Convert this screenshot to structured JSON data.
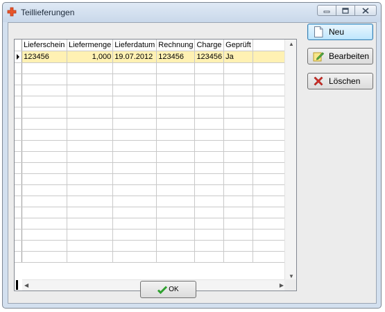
{
  "window": {
    "title": "Teillieferungen"
  },
  "table": {
    "columns": [
      "Lieferschein",
      "Liefermenge",
      "Lieferdatum",
      "Rechnung",
      "Charge",
      "Geprüft",
      ""
    ],
    "rows": [
      [
        "123456",
        "1,000",
        "19.07.2012",
        "123456",
        "123456",
        "Ja",
        ""
      ]
    ],
    "empty_rows": 18
  },
  "buttons": {
    "new_label": "Neu",
    "edit_label": "Bearbeiten",
    "delete_label": "Löschen",
    "ok_label": "OK"
  },
  "colors": {
    "selected_row": "#fff1b3",
    "default_button": "#bee6fd",
    "delete_icon": "#d9302a",
    "ok_icon": "#2fa12f"
  }
}
